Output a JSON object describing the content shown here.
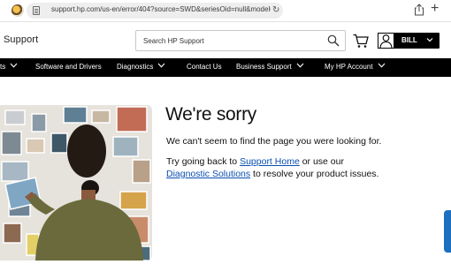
{
  "browser": {
    "url": "support.hp.com/us-en/error/404?source=SWD&seriesOid=null&modelOid=..."
  },
  "header": {
    "title": "Support",
    "search_placeholder": "Search HP Support",
    "user_name": "BILL"
  },
  "nav": {
    "items": [
      {
        "label": "ts",
        "has_chevron": true
      },
      {
        "label": "Software and Drivers",
        "has_chevron": false
      },
      {
        "label": "Diagnostics",
        "has_chevron": true
      },
      {
        "label": "Contact Us",
        "has_chevron": false
      },
      {
        "label": "Business Support",
        "has_chevron": true
      },
      {
        "label": "My HP Account",
        "has_chevron": true
      }
    ]
  },
  "error": {
    "heading": "We're sorry",
    "message": "We can't seem to find the page you were looking for.",
    "suggest_prefix": "Try going back to ",
    "support_home_link": "Support Home",
    "suggest_middle": " or use our",
    "diagnostic_link": "Diagnostic Solutions",
    "suggest_suffix": " to resolve your product issues."
  },
  "colors": {
    "nav_background": "#000000",
    "link": "#0b4fb0",
    "side_tab": "#1d6fbf"
  },
  "icons": [
    "favicon",
    "page-icon",
    "reload-icon",
    "share-icon",
    "plus-icon",
    "search-icon",
    "cart-icon",
    "user-icon",
    "chevron-down-icon"
  ]
}
